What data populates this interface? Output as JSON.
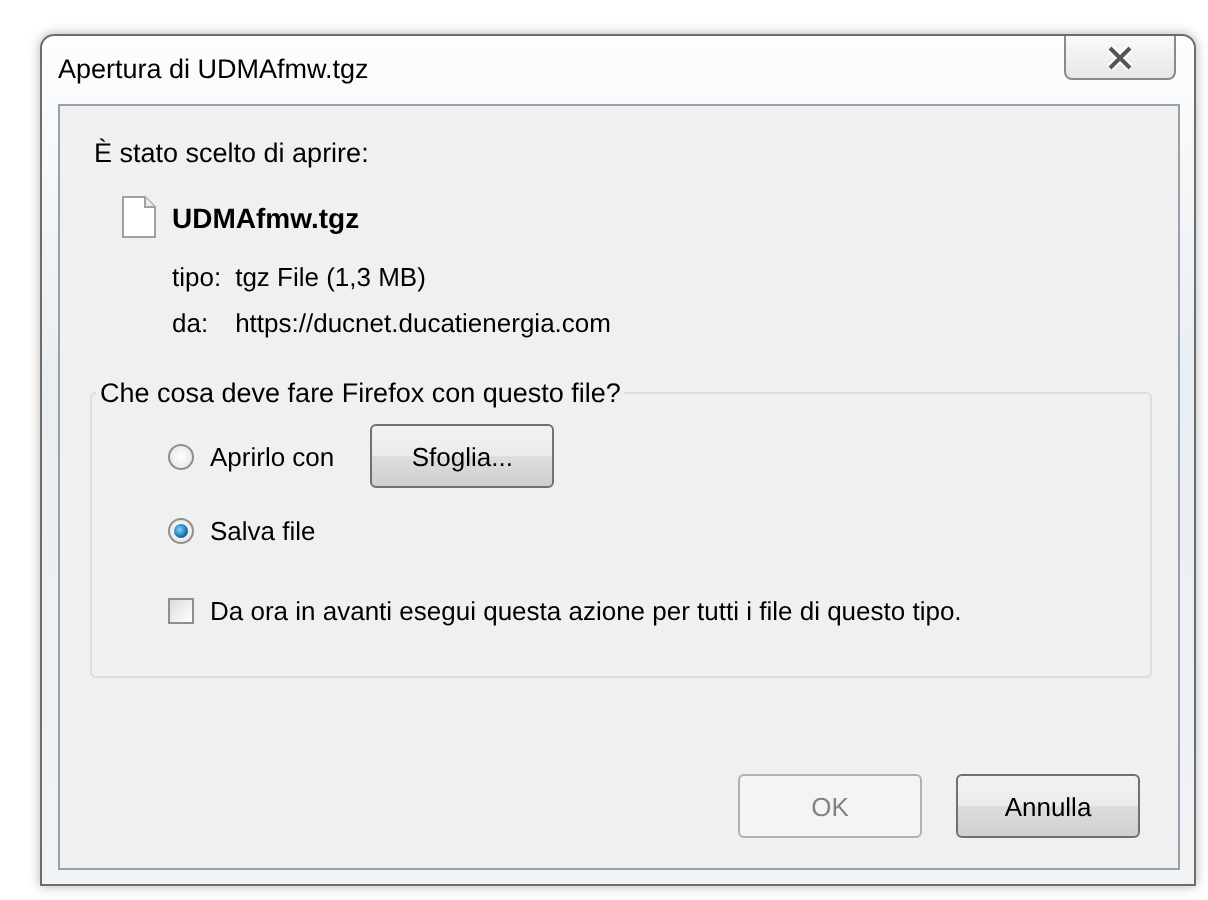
{
  "window": {
    "title": "Apertura di UDMAfmw.tgz"
  },
  "intro": "È stato scelto di aprire:",
  "file": {
    "name": "UDMAfmw.tgz",
    "details": [
      {
        "label": "tipo:",
        "value": "tgz File (1,3 MB)"
      },
      {
        "label": "da:",
        "value": "https://ducnet.ducatienergia.com"
      }
    ]
  },
  "group": {
    "legend": "Che cosa deve fare Firefox con questo file?",
    "options": [
      {
        "label": "Aprirlo con",
        "selected": false,
        "button": {
          "label": "Sfoglia..."
        }
      },
      {
        "label": "Salva file",
        "selected": true
      }
    ],
    "remember": {
      "label": "Da ora in avanti esegui questa azione per tutti i file di questo tipo.",
      "checked": false
    }
  },
  "buttons": [
    {
      "label": "OK",
      "disabled": true
    },
    {
      "label": "Annulla",
      "disabled": false
    }
  ]
}
